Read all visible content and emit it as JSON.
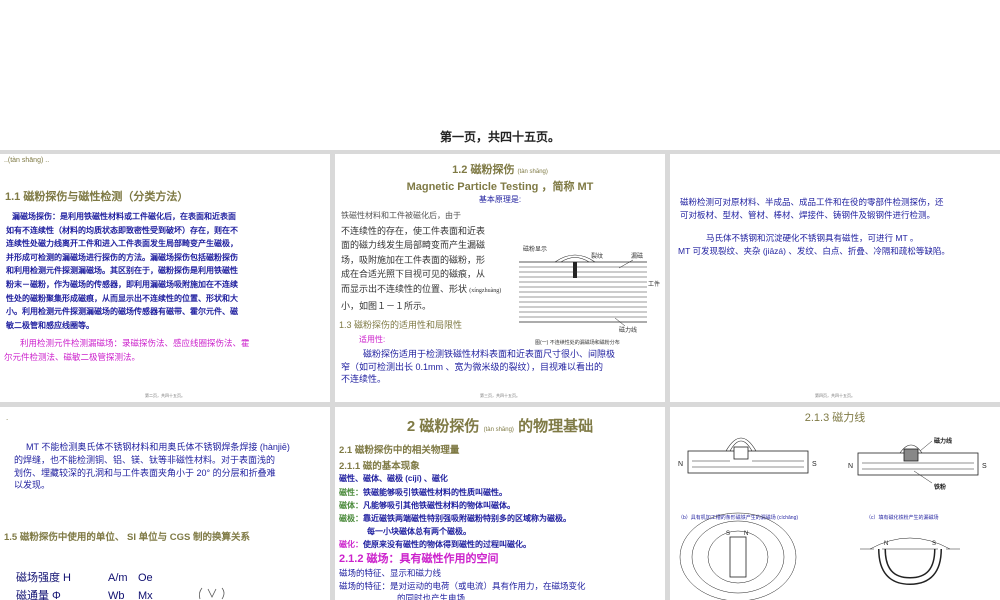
{
  "top": {
    "page_caption": "第一页，共四十五页。"
  },
  "slide1": {
    "corner": "..(tàn shāng) ..",
    "title": "1.1  磁粉探伤与磁性检测（分类方法）",
    "para_lines": [
      "漏磁场探伤：是利用铁磁性材料或工件磁化后，在表面和近表面",
      "如有不连续性（材料的均质状态即致密性受到破坏）存在，则在不",
      "连续性处磁力线离开工件和进入工件表面发生局部畸变产生磁极，",
      "并形成可检测的漏磁场进行探伤的方法。漏磁场探伤包括磁粉探伤",
      "和利用检测元件探测漏磁场。其区别在于，磁粉探伤是利用铁磁性",
      "粉末－磁粉，作为磁场的传感器，即利用漏磁场吸附施加在不连续",
      "性处的磁粉聚集形成磁痕，从而显示出不连续性的位置、形状和大",
      "小。利用检测元件探测漏磁场的磁场传感器有磁带、霍尔元件、磁",
      "敏二极管和感应线圈等。"
    ],
    "magenta_lines": [
      "利用检测元件检测漏磁场：录磁探伤法、感应线圈探伤法、霍",
      "尔元件检测法、磁敏二极管探测法。"
    ],
    "footer": "第二页，共四十五页。"
  },
  "slide2": {
    "title": "1.2  磁粉探伤",
    "title_ruby": "(tàn shāng)",
    "subtitle": "Magnetic Particle Testing ，简称  MT",
    "principle": "基本原理是:",
    "body_lines": [
      "铁磁性材料和工件被磁化后，由于",
      "不连续性的存在，使工件表面和近表",
      "面的磁力线发生局部畸变而产生漏磁",
      "场，吸附施加在工件表面的磁粉，形",
      "成在合适光照下目视可见的磁痕，从",
      "而显示出不连续性的位置、形状",
      "小，如图１－１所示。"
    ],
    "shape_ruby": "(xíngzhuàng)",
    "fig_labels": {
      "powder": "磁粉显示",
      "crack": "裂纹",
      "leak": "漏磁",
      "workpiece": "工件",
      "flux": "磁力线"
    },
    "fig_caption": "图(一)  不连续性处的漏磁场和磁粉分布",
    "section": "1.3    磁粉探伤的适用性和局限性",
    "suit": "适用性:",
    "suit_lines": [
      "磁粉探伤适用于检测铁磁性材料表面和近表面尺寸很小、间隙极",
      "窄（如可检测出长 0.1mm 、宽为微米级的裂纹），目视难以看出的",
      "不连续性。"
    ],
    "footer": "第三页，共四十五页。"
  },
  "slide3": {
    "lines": [
      "磁粉检测可对原材料、半成品、成品工件和在役的零部件检测探伤，还",
      "可对板材、型材、管材、棒材、焊接件、铸钢件及锻钢件进行检测。"
    ],
    "lines2": [
      "马氏体不锈钢和沉淀硬化不锈钢具有磁性，可进行 MT 。",
      "MT 可发现裂纹、夹杂 (jiāzá) 、发纹、白点、折叠、冷隔和疏松等缺陷。"
    ],
    "footer": "第四页，共四十五页。"
  },
  "slide4": {
    "dot": ".",
    "lines": [
      "MT 不能检测奥氏体不锈钢材料和用奥氏体不锈钢焊条焊接 (hànjiē)",
      "的焊缝，也不能检测铜、铝、镁、钛等非磁性材料。对于表面浅的",
      "划伤、埋藏较深的孔洞和与工件表面夹角小于 20° 的分层和折叠难",
      "以发现。"
    ],
    "section": "1.5  磁粉探伤中使用的单位、 SI 单位与 CGS 制的换算关系",
    "rows": [
      {
        "name": "磁场强度 H",
        "si": "A/m",
        "cgs": "Oe"
      },
      {
        "name": "磁通量  Φ",
        "si": "Wb",
        "cgs": "Mx"
      }
    ]
  },
  "slide5": {
    "title": "2  磁粉探伤",
    "title_ruby": "(tàn shāng)",
    "title_suffix": "的物理基础",
    "h1": "2.1  磁粉探伤中的相关物理量",
    "h2": "2.1.1  磁的基本现象",
    "terms_head": "磁性、磁体、磁极 (cíjí) 、磁化",
    "defs": [
      {
        "term": "磁性：",
        "text": "铁磁能够吸引铁磁性材料的性质叫磁性。"
      },
      {
        "term": "磁体：",
        "text": "凡能够吸引其他铁磁性材料的物体叫磁体。"
      },
      {
        "term": "磁极：",
        "text": "靠近磁铁两端磁性特别强吸附磁粉特别多的区域称为磁极。"
      }
    ],
    "note": "每一小块磁体总有两个磁极。",
    "magnetize": {
      "term": "磁化：",
      "text": "使原来没有磁性的物体得到磁性的过程叫磁化。"
    },
    "h3": "2.1.2  磁场：具有磁性作用的空间",
    "feat": "磁场的特征、显示和磁力线",
    "feat2": "磁场的特征：是对运动的电荷（或电流）具有作用力，在磁场变化",
    "feat3": "的同时也产生电场"
  },
  "slide6": {
    "title": "2.1.3 磁力线",
    "label_flux": "磁力线",
    "label_iron": "铁粉",
    "cap_b": "（b）具有机加工槽的条形磁铁产生的漏磁场 (cíchǎng)",
    "cap_c": "（c）填有磁化铁粉产生的漏磁场",
    "n": "N",
    "s": "S"
  }
}
